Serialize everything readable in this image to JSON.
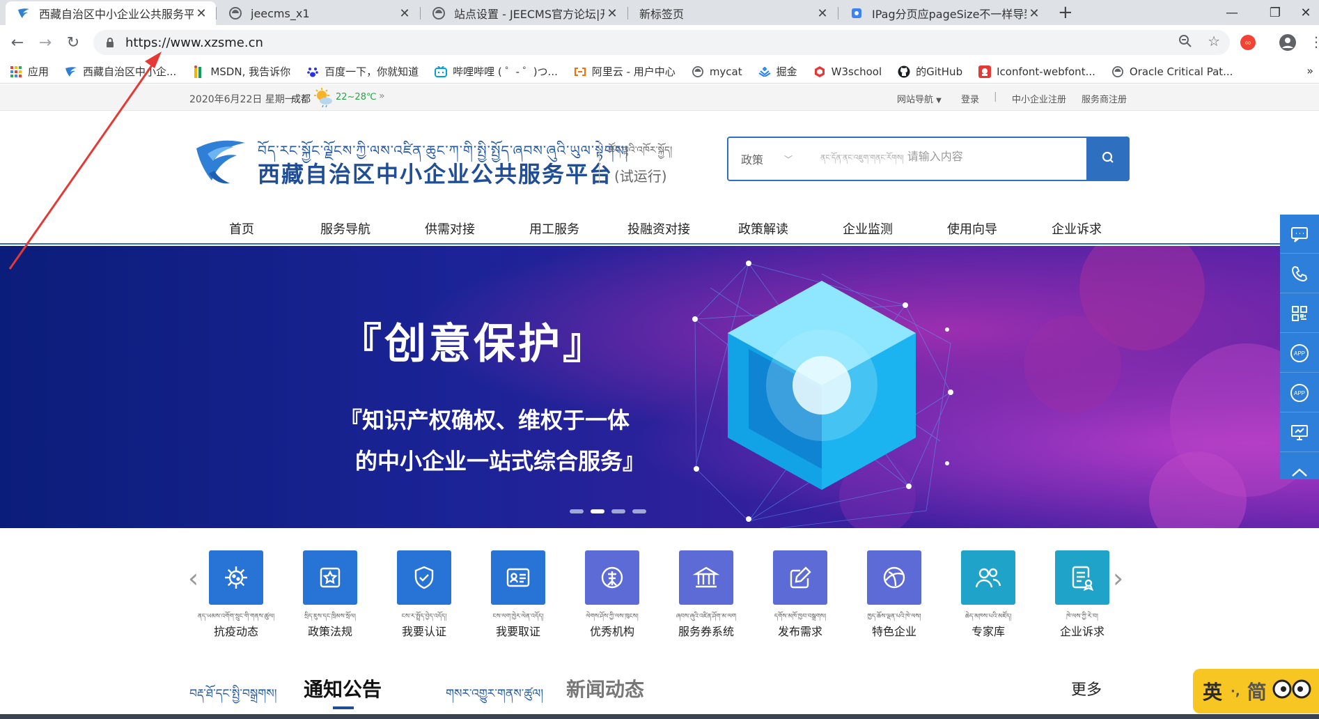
{
  "browser": {
    "tabs": [
      {
        "title": "西藏自治区中小企业公共服务平台",
        "active": true
      },
      {
        "title": "jeecms_x1",
        "active": false
      },
      {
        "title": "站点设置 - JEECMS官方论坛|开源",
        "active": false
      },
      {
        "title": "新标签页",
        "active": false
      },
      {
        "title": "IPag分页应pageSize不一样导致",
        "active": false
      }
    ],
    "url": "https://www.xzsme.cn",
    "bookmarks": [
      {
        "label": "应用",
        "icon": "apps-grid-icon"
      },
      {
        "label": "西藏自治区中小企...",
        "icon": "site-logo-icon"
      },
      {
        "label": "MSDN, 我告诉你",
        "icon": "msdn-icon"
      },
      {
        "label": "百度一下，你就知道",
        "icon": "baidu-paw-icon"
      },
      {
        "label": "哔哩哔哩 ( ゜- ゜)つ...",
        "icon": "bilibili-icon"
      },
      {
        "label": "阿里云 - 用户中心",
        "icon": "aliyun-icon"
      },
      {
        "label": "mycat",
        "icon": "globe-icon"
      },
      {
        "label": "掘金",
        "icon": "juejin-icon"
      },
      {
        "label": "W3school",
        "icon": "w3school-icon"
      },
      {
        "label": "的GitHub",
        "icon": "github-icon"
      },
      {
        "label": "Iconfont-webfont...",
        "icon": "iconfont-icon"
      },
      {
        "label": "Oracle Critical Pat...",
        "icon": "globe-icon"
      }
    ],
    "bookmarks_more": "»",
    "colors": {
      "accent": "#1a73e8",
      "annotation_arrow": "#e53935"
    }
  },
  "topbar": {
    "date": "2020年6月22日 星期一",
    "city": "成都",
    "temperature": "22~28℃",
    "more": "»",
    "links": [
      "网站导航",
      "登录",
      "中小企业注册",
      "服务商注册"
    ],
    "separator": "|"
  },
  "header": {
    "tibetan_title": "བོད་རང་སྐྱོང་ལྗོངས་ཀྱི་ལས་འཛིན་ཆུང་ཀ་གི་སྤྱི་སྤྱོད་ཞབས་ཞུའི་ཡུལ་སྟེགས།",
    "title": "西藏自治区中小企业公共服务平台",
    "trial_tibetan": "ཚོད་ལྟའི་འཁོར་སྐྱོད།",
    "trial": "(试运行)",
    "search_category": "政策",
    "search_placeholder_tibetan": "ནང་དོན་ནང་འཇུག་གནང་རོགས།",
    "search_placeholder": "请输入内容",
    "colors": {
      "brand": "#2e6fc0",
      "title": "#1f4e96"
    }
  },
  "nav": [
    "首页",
    "服务导航",
    "供需对接",
    "用工服务",
    "投融资对接",
    "政策解读",
    "企业监测",
    "使用向导",
    "企业诉求"
  ],
  "banner": {
    "headline": "『创意保护』",
    "line1": "『知识产权确权、维权于一体",
    "line2": "的中小企业一站式综合服务』",
    "slides": 4,
    "active_slide": 2
  },
  "services": [
    {
      "label": "抗疫动态",
      "tibetan": "ནད་ཡམས་འགོག་སྲུང་གི་གནས་ཚུལ།",
      "icon": "virus-icon",
      "color": "#2873d6"
    },
    {
      "label": "政策法规",
      "tibetan": "སྲིད་ཇུས་དང་ཁྲིམས་སྲོལ།",
      "icon": "policy-star-icon",
      "color": "#2873d6"
    },
    {
      "label": "我要认证",
      "tibetan": "ངས་ར་སྤྲོད་བྱེད་འདོད།",
      "icon": "shield-check-icon",
      "color": "#2873d6"
    },
    {
      "label": "我要取证",
      "tibetan": "ངས་ལག་ཁྱེར་ལེན་འདོད།",
      "icon": "id-card-icon",
      "color": "#2873d6"
    },
    {
      "label": "优秀机构",
      "tibetan": "ལེགས་ཤོས་ཀྱི་ལས་ཁུངས།",
      "icon": "enterprise-badge-icon",
      "color": "#5d6bd6"
    },
    {
      "label": "服务券系统",
      "tibetan": "ཞབས་ཞུའི་འཛིན་ཤོག་མ་ལག",
      "icon": "bank-building-icon",
      "color": "#5d6bd6"
    },
    {
      "label": "发布需求",
      "tibetan": "དགོས་མཁོ་ཁྱབ་བསྒྲགས།",
      "icon": "edit-note-icon",
      "color": "#5d6bd6"
    },
    {
      "label": "特色企业",
      "tibetan": "ཁྱད་ཆོས་ལྡན་པའི་ཁེ་ལས།",
      "icon": "globe-enterprise-icon",
      "color": "#5d6bd6"
    },
    {
      "label": "专家库",
      "tibetan": "ཆེད་མཁས་པའི་མཛོད།",
      "icon": "experts-icon",
      "color": "#1fa3c9"
    },
    {
      "label": "企业诉求",
      "tibetan": "ཁེ་ལས་ཀྱི་རེ་བ།",
      "icon": "appeal-doc-icon",
      "color": "#1fa3c9"
    }
  ],
  "sections": {
    "notice_tibetan": "བརྡ་ཐོ་དང་སྤྱི་བསྒྲགས།",
    "notice": "通知公告",
    "news_tibetan": "གསར་འགྱུར་གནས་ཚུལ།",
    "news": "新闻动态",
    "more": "更多"
  },
  "sidebar_tools": [
    "chat-icon",
    "phone-icon",
    "qrcode-icon",
    "app-icon",
    "app-icon",
    "monitor-icon",
    "back-to-top-icon"
  ],
  "ime": {
    "mode": "英",
    "sep": "·,",
    "variant": "简"
  }
}
